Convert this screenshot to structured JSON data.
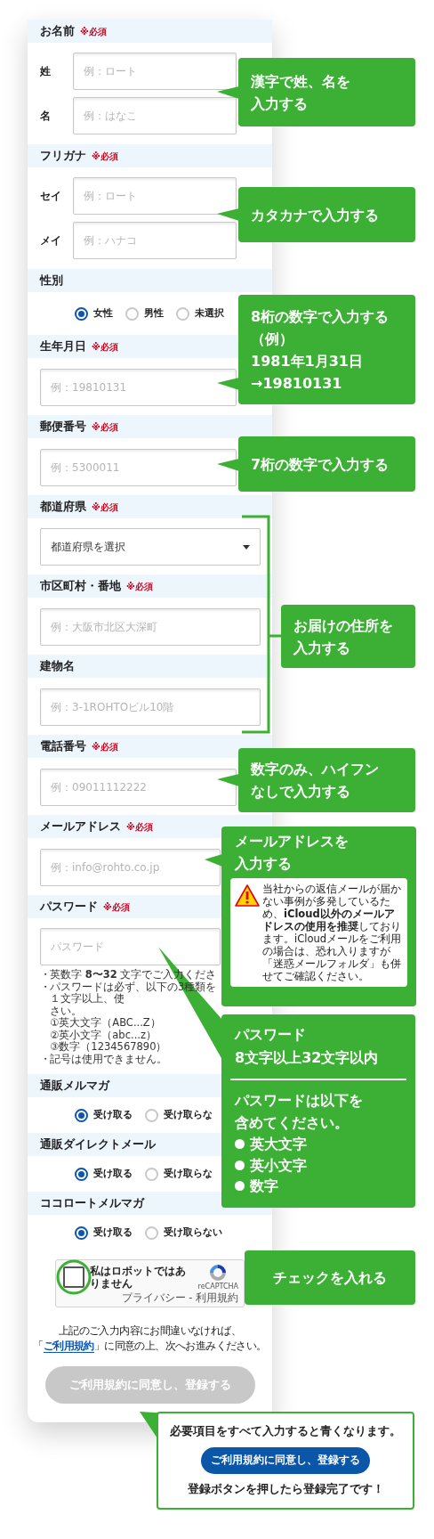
{
  "form": {
    "sections": [
      {
        "kind": "pair",
        "label": "お名前",
        "required": "※必須",
        "fields": [
          {
            "label": "姓",
            "placeholder": "例：ロート"
          },
          {
            "label": "名",
            "placeholder": "例：はなこ"
          }
        ]
      },
      {
        "kind": "pair",
        "label": "フリガナ",
        "required": "※必須",
        "fields": [
          {
            "label": "セイ",
            "placeholder": "例：ロート"
          },
          {
            "label": "メイ",
            "placeholder": "例：ハナコ"
          }
        ]
      },
      {
        "kind": "radio",
        "label": "性別",
        "options": [
          {
            "label": "女性",
            "selected": true
          },
          {
            "label": "男性",
            "selected": false
          },
          {
            "label": "未選択",
            "selected": false
          }
        ]
      },
      {
        "kind": "input",
        "label": "生年月日",
        "required": "※必須",
        "placeholder": "例：19810131"
      },
      {
        "kind": "input",
        "label": "郵便番号",
        "required": "※必須",
        "placeholder": "例：5300011"
      },
      {
        "kind": "select",
        "label": "都道府県",
        "required": "※必須",
        "value": "都道府県を選択"
      },
      {
        "kind": "input",
        "label": "市区町村・番地",
        "required": "※必須",
        "placeholder": "例：大阪市北区大深町"
      },
      {
        "kind": "input",
        "label": "建物名",
        "placeholder": "例：3-1ROHTOビル10階"
      },
      {
        "kind": "input",
        "label": "電話番号",
        "required": "※必須",
        "placeholder": "例：09011112222"
      },
      {
        "kind": "input",
        "label": "メールアドレス",
        "required": "※必須",
        "placeholder": "例：info@rohto.co.jp"
      },
      {
        "kind": "password",
        "label": "パスワード",
        "required": "※必須",
        "placeholder": "パスワード",
        "notes": [
          {
            "bullet": "・",
            "text": "英数字 **8〜32** 文字でご入力くださ"
          },
          {
            "bullet": "・",
            "text": "パスワードは必ず、以下の3種類を１文字以上、使"
          },
          {
            "text": "さい。"
          },
          {
            "text": "①英大文字（ABC...Z）"
          },
          {
            "text": "②英小文字（abc...z）"
          },
          {
            "text": "③数字（1234567890）"
          },
          {
            "bullet": "・",
            "text": "記号は使用できません。"
          }
        ]
      },
      {
        "kind": "radio",
        "label": "通販メルマガ",
        "options": [
          {
            "label": "受け取る",
            "selected": true
          },
          {
            "label": "受け取らな",
            "selected": false
          }
        ]
      },
      {
        "kind": "radio",
        "label": "通販ダイレクトメール",
        "options": [
          {
            "label": "受け取る",
            "selected": true
          },
          {
            "label": "受け取らな",
            "selected": false
          }
        ]
      },
      {
        "kind": "radio",
        "label": "ココロートメルマガ",
        "options": [
          {
            "label": "受け取る",
            "selected": true
          },
          {
            "label": "受け取らない",
            "selected": false
          }
        ]
      }
    ],
    "captcha": {
      "label": "私はロボットではありません",
      "checked": false,
      "brand": "reCAPTCHA",
      "links": "プライバシー - 利用規約"
    },
    "agreement": {
      "line1": "上記のご入力内容にお間違いなければ、",
      "before": "「",
      "link": "ご利用規約",
      "after": "」に同意の上、次へお進みください。"
    },
    "submit_button": {
      "label": "ご利用規約に同意し、登録する",
      "disabled": true
    }
  },
  "callouts": [
    {
      "kind": "plain",
      "lines": [
        "漢字で姓、名を",
        "入力する"
      ]
    },
    {
      "kind": "plain",
      "lines": [
        "カタカナで入力する"
      ]
    },
    {
      "kind": "plain",
      "lines": [
        "8桁の数字で入力する",
        "（例）",
        "1981年1月31日",
        "→19810131"
      ]
    },
    {
      "kind": "plain",
      "lines": [
        "7桁の数字で入力する"
      ]
    },
    {
      "kind": "plain",
      "lines": [
        "お届けの住所を",
        "入力する"
      ]
    },
    {
      "kind": "plain",
      "lines": [
        "数字のみ、ハイフン",
        "なしで入力する"
      ]
    },
    {
      "kind": "email",
      "lines": [
        "メールアドレスを",
        "入力する"
      ],
      "warning": "当社からの返信メールが届かない事例が多発しているため、**iCloud以外のメールアドレスの使用を推奨**しております。iCloudメールをご利用の場合は、恐れ入りますが「迷惑メールフォルダ」も併せてご確認ください。"
    },
    {
      "kind": "password",
      "lines": [
        "パスワード",
        "8文字以上32文字以内"
      ],
      "rules_title": [
        "パスワードは以下を",
        "含めてください。"
      ],
      "rules": [
        "英大文字",
        "英小文字",
        "数字"
      ]
    },
    {
      "kind": "plain",
      "lines": [
        "チェックを入れる"
      ]
    },
    {
      "kind": "outline",
      "lines": [
        "必要項目をすべて入力すると青くなります。",
        "登録ボタンを押したら登録完了です！"
      ],
      "button": "ご利用規約に同意し、登録する"
    }
  ]
}
